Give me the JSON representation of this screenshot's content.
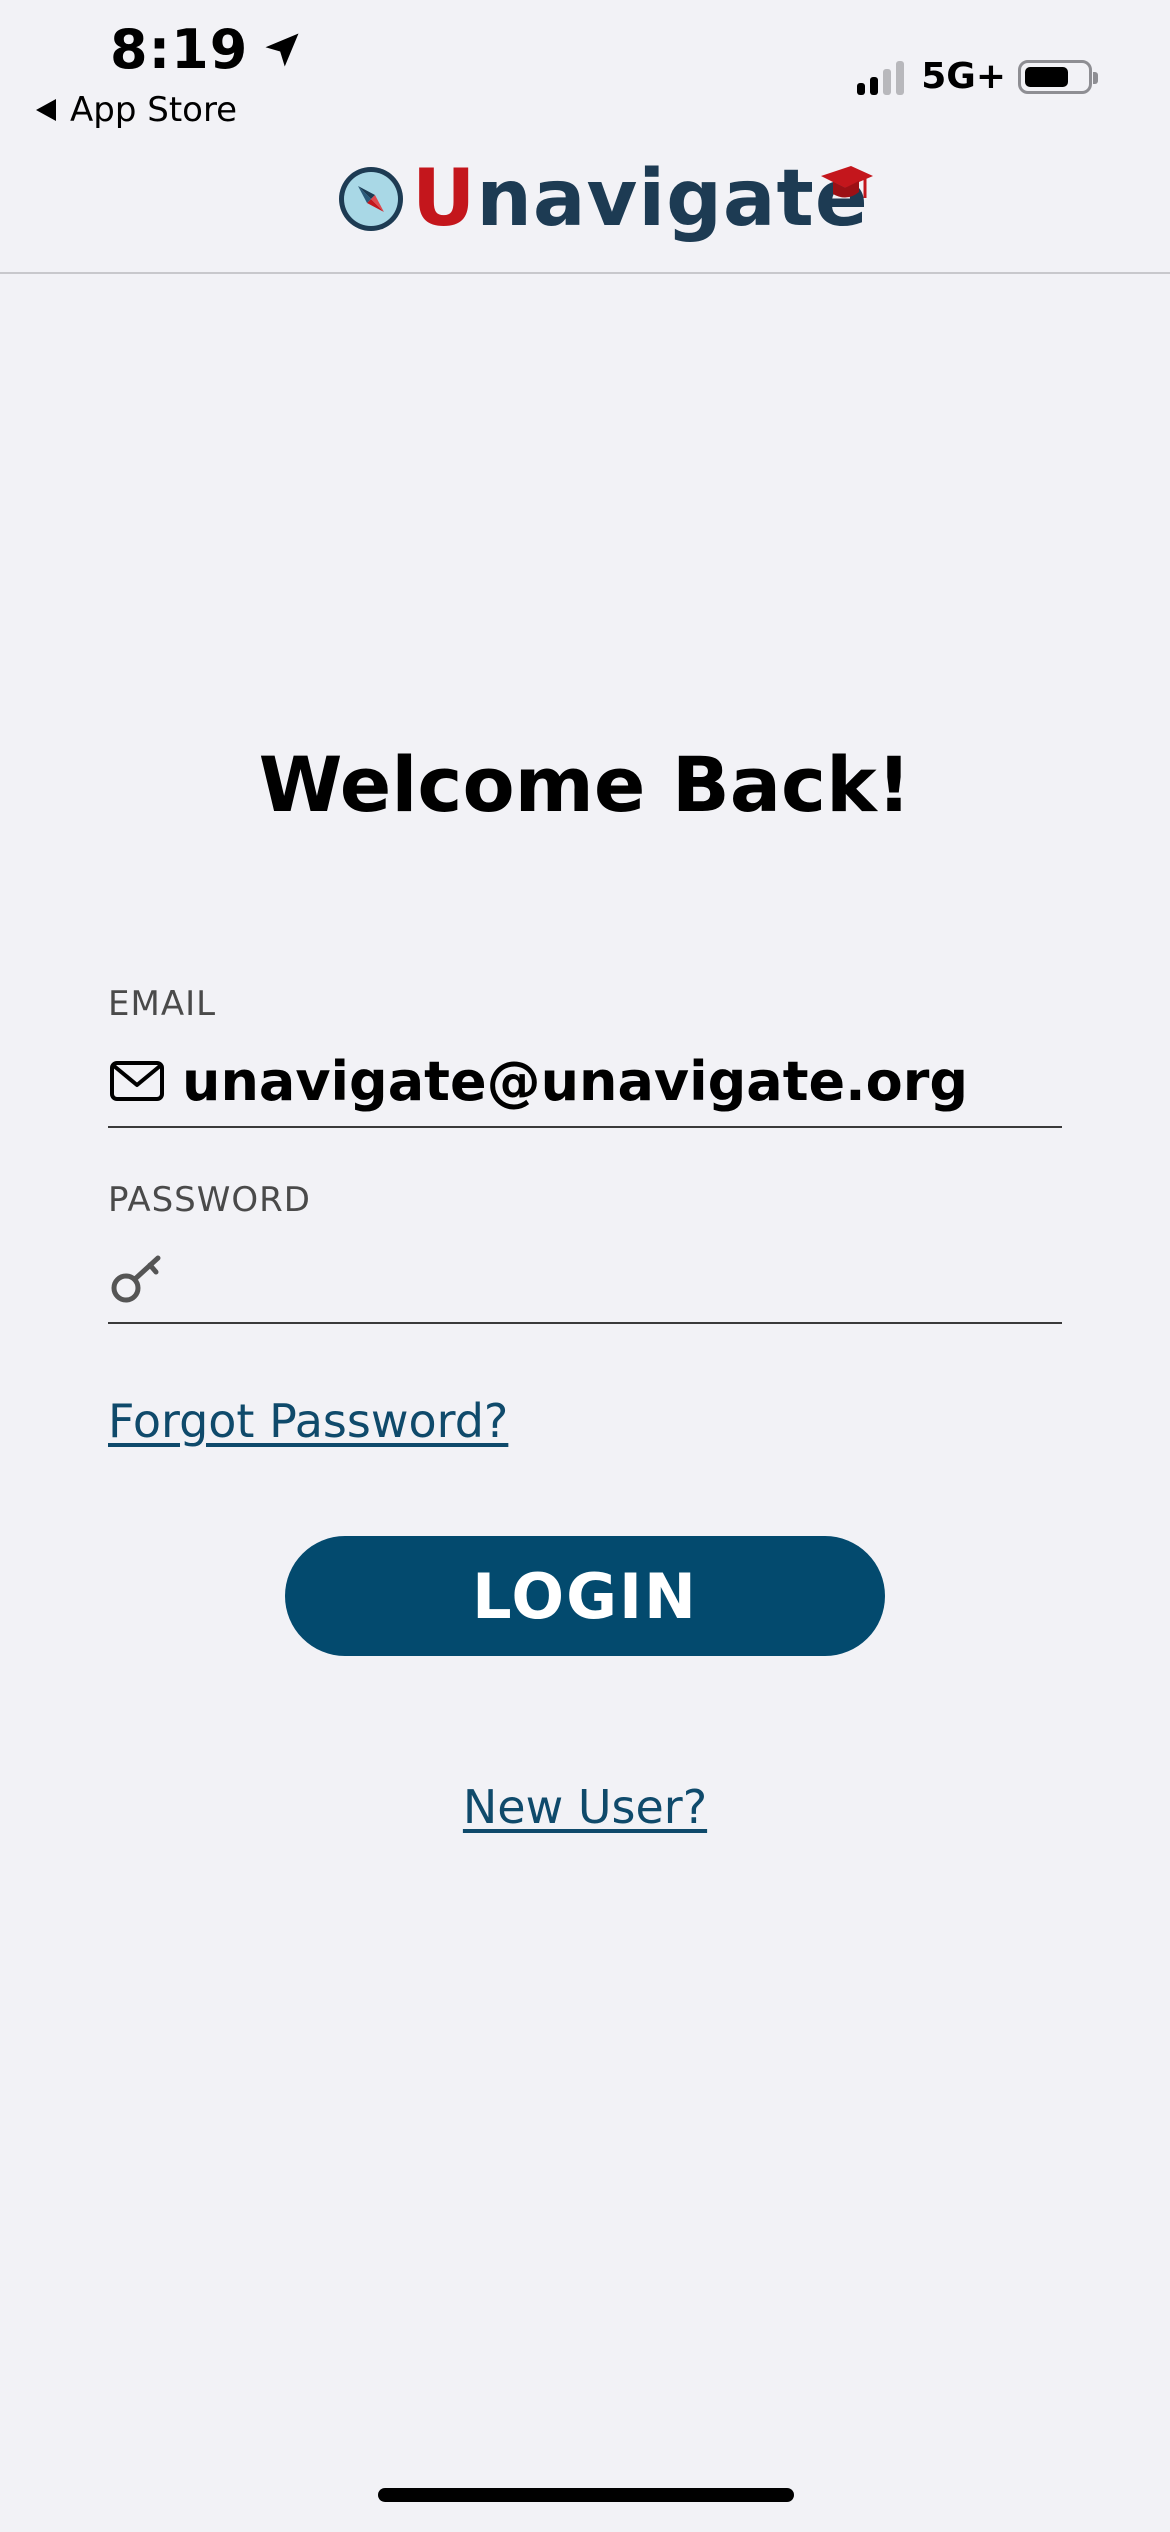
{
  "status_bar": {
    "time": "8:19",
    "back_label": "App Store",
    "network": "5G+",
    "location_icon": "location-arrow-icon",
    "battery_level": 0.72
  },
  "header": {
    "logo_text_first": "U",
    "logo_text_rest": "navigate",
    "logo_icons": [
      "compass-icon",
      "graduation-cap-icon"
    ],
    "colors": {
      "brand_red": "#c4161c",
      "brand_navy": "#1d3b53"
    }
  },
  "main": {
    "title": "Welcome Back!",
    "email": {
      "label": "EMAIL",
      "value": "unavigate@unavigate.org",
      "icon": "envelope-icon"
    },
    "password": {
      "label": "PASSWORD",
      "value": "",
      "icon": "key-icon"
    },
    "forgot_link": "Forgot Password?",
    "login_button": "LOGIN",
    "new_user_link": "New User?",
    "colors": {
      "button": "#034a6e",
      "link": "#0f4a6b"
    }
  }
}
